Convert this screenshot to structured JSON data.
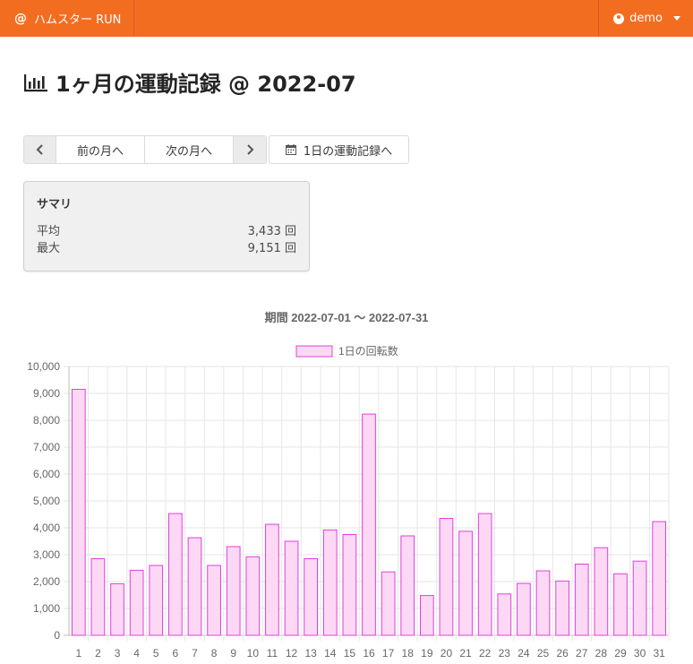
{
  "navbar": {
    "brand_icon": "@",
    "brand": "ハムスター RUN",
    "user": "demo"
  },
  "page": {
    "title": "1ヶ月の運動記録 @ 2022-07"
  },
  "nav": {
    "prev_label": "前の月へ",
    "next_label": "次の月へ",
    "day_label": "1日の運動記録へ"
  },
  "summary": {
    "title": "サマリ",
    "rows": [
      {
        "label": "平均",
        "value": "3,433 回"
      },
      {
        "label": "最大",
        "value": "9,151 回"
      }
    ]
  },
  "colors": {
    "accent": "#f36d21",
    "bar_fill": "#fdd8f5",
    "bar_border": "#e040d8"
  },
  "chart_data": {
    "type": "bar",
    "title": "期間 2022-07-01 〜 2022-07-31",
    "legend": "top",
    "ylim": [
      0,
      10000
    ],
    "y_ticks": [
      "0",
      "1,000",
      "2,000",
      "3,000",
      "4,000",
      "5,000",
      "6,000",
      "7,000",
      "8,000",
      "9,000",
      "10,000"
    ],
    "categories": [
      "1",
      "2",
      "3",
      "4",
      "5",
      "6",
      "7",
      "8",
      "9",
      "10",
      "11",
      "12",
      "13",
      "14",
      "15",
      "16",
      "17",
      "18",
      "19",
      "20",
      "21",
      "22",
      "23",
      "24",
      "25",
      "26",
      "27",
      "28",
      "29",
      "30",
      "31"
    ],
    "series": [
      {
        "name": "1日の回転数",
        "values": [
          9151,
          2850,
          1920,
          2420,
          2600,
          4530,
          3630,
          2600,
          3300,
          2920,
          4130,
          3500,
          2850,
          3920,
          3750,
          8230,
          2360,
          3700,
          1480,
          4350,
          3870,
          4530,
          1540,
          1930,
          2400,
          2020,
          2650,
          3260,
          2290,
          2760,
          4230
        ]
      }
    ],
    "grid": true
  }
}
